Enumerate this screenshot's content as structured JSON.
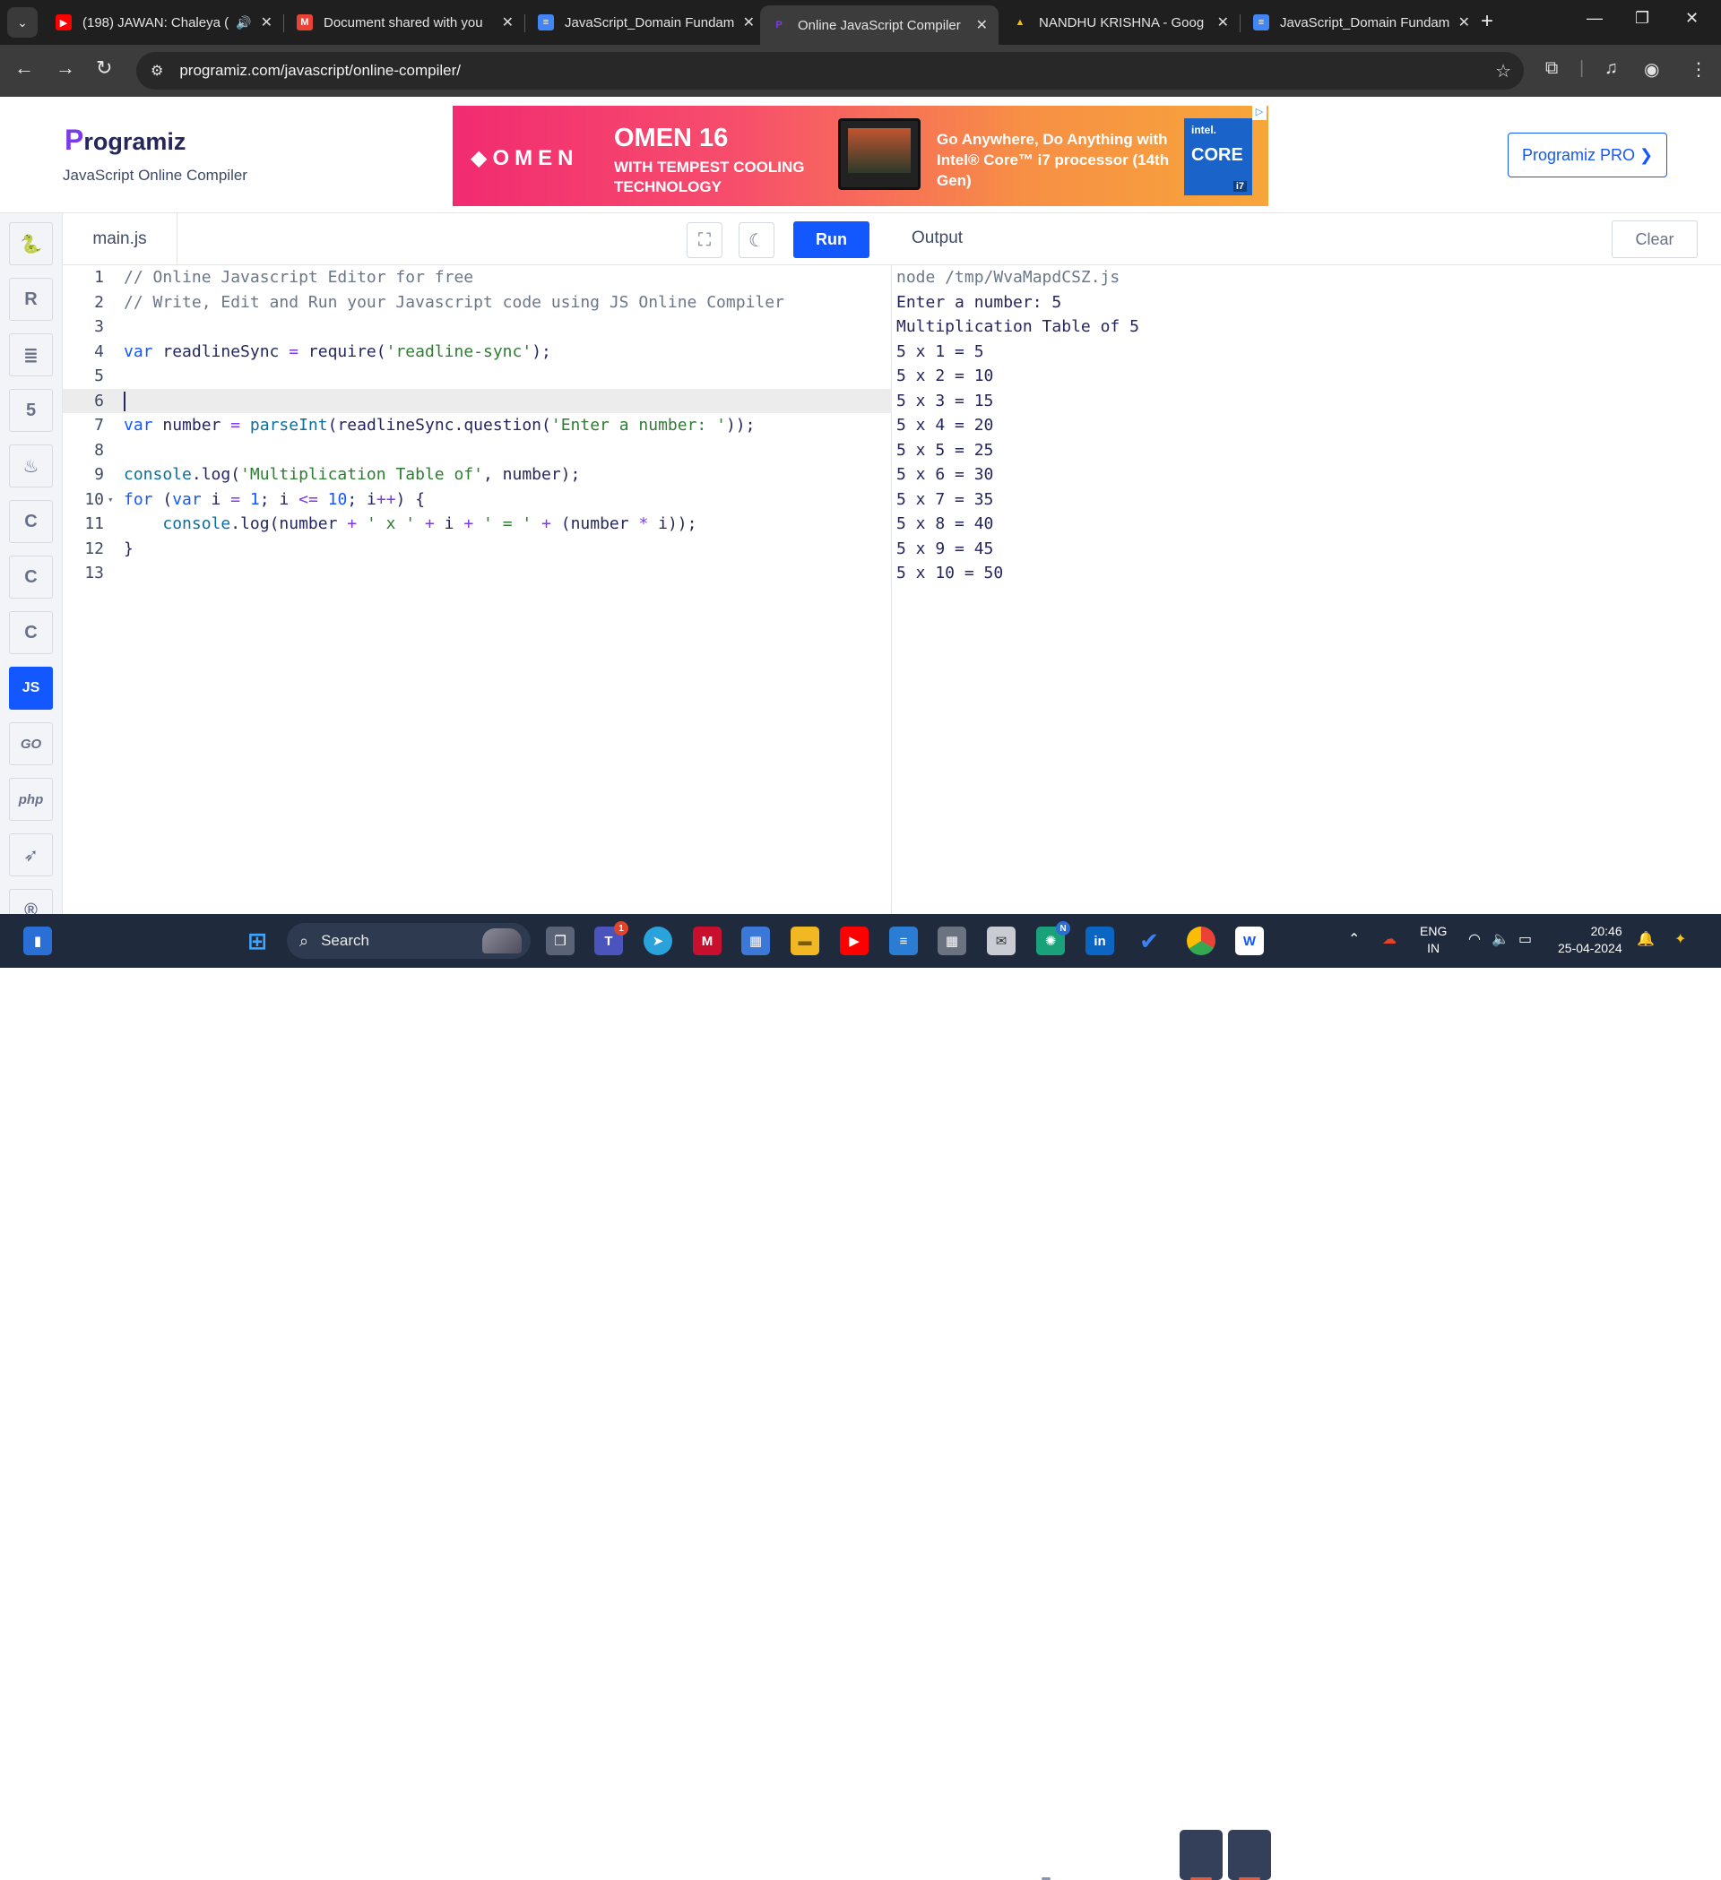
{
  "browser": {
    "tabs": [
      {
        "title": "(198) JAWAN: Chaleya (",
        "icon": "youtube-icon",
        "icon_color": "#ff0000",
        "extra": "speaker-icon"
      },
      {
        "title": "Document shared with you",
        "icon": "gmail-icon",
        "icon_color": "#ea4335"
      },
      {
        "title": "JavaScript_Domain Fundam",
        "icon": "google-docs-icon",
        "icon_color": "#4285f4"
      },
      {
        "title": "Online JavaScript Compiler",
        "icon": "programiz-icon",
        "icon_color": "#7c3aed",
        "active": true
      },
      {
        "title": "NANDHU KRISHNA - Goog",
        "icon": "google-drive-icon",
        "icon_color": "#fbbc04"
      },
      {
        "title": "JavaScript_Domain Fundam",
        "icon": "google-docs-icon",
        "icon_color": "#4285f4"
      }
    ],
    "url": "programiz.com/javascript/online-compiler/"
  },
  "header": {
    "logo_initial": "P",
    "logo_text": "rogramiz",
    "subtitle": "JavaScript Online Compiler",
    "pro_button": "Programiz PRO ❯"
  },
  "ad": {
    "brand": "◆OMEN",
    "headline": "OMEN 16",
    "subline": "WITH TEMPEST COOLING TECHNOLOGY",
    "tagline": "Go Anywhere, Do Anything with Intel® Core™ i7 processor (14th Gen)",
    "intel_brand": "intel.",
    "intel_core": "CORE",
    "intel_tier": "i7"
  },
  "sidebar": {
    "languages": [
      {
        "name": "python-icon",
        "glyph": "🐍"
      },
      {
        "name": "r-icon",
        "glyph": "R"
      },
      {
        "name": "sql-icon",
        "glyph": "≣"
      },
      {
        "name": "html-icon",
        "glyph": "5"
      },
      {
        "name": "java-icon",
        "glyph": "♨"
      },
      {
        "name": "c-icon",
        "glyph": "C"
      },
      {
        "name": "cpp-icon",
        "glyph": "C"
      },
      {
        "name": "csharp-icon",
        "glyph": "C"
      },
      {
        "name": "javascript-icon",
        "glyph": "JS",
        "active": true
      },
      {
        "name": "go-icon",
        "glyph": "GO"
      },
      {
        "name": "php-icon",
        "glyph": "php"
      },
      {
        "name": "swift-icon",
        "glyph": "➶"
      },
      {
        "name": "rust-icon",
        "glyph": "®"
      }
    ]
  },
  "editor": {
    "file_name": "main.js",
    "run_label": "Run",
    "current_line": 6,
    "lines": [
      "<span class=\"cm\">// Online Javascript Editor for free</span>",
      "<span class=\"cm\">// Write, Edit and Run your Javascript code using JS Online Compiler</span>",
      "",
      "<span class=\"kw\">var</span> readlineSync <span class=\"op\">=</span> require(<span class=\"str\">'readline-sync'</span>);",
      "",
      "<span class=\"caret\"></span>",
      "<span class=\"kw\">var</span> number <span class=\"op\">=</span> <span class=\"fn\">parseInt</span>(readlineSync.question(<span class=\"str\">'Enter a number: '</span>));",
      "",
      "<span class=\"fn\">console</span>.log(<span class=\"str\">'Multiplication Table of'</span>, number);",
      "<span class=\"kw\">for</span> (<span class=\"kw\">var</span> i <span class=\"op\">=</span> <span class=\"num\">1</span>; i <span class=\"op\">&lt;=</span> <span class=\"num\">10</span>; i<span class=\"op\">++</span>) {",
      "    <span class=\"fn\">console</span>.log(number <span class=\"op\">+</span> <span class=\"str\">' x '</span> <span class=\"op\">+</span> i <span class=\"op\">+</span> <span class=\"str\">' = '</span> <span class=\"op\">+</span> (number <span class=\"op\">*</span> i));",
      "}",
      ""
    ]
  },
  "output": {
    "title": "Output",
    "clear_label": "Clear",
    "command": "node /tmp/WvaMapdCSZ.js",
    "lines": [
      "Enter a number: 5",
      "Multiplication Table of 5",
      "5 x 1 = 5",
      "5 x 2 = 10",
      "5 x 3 = 15",
      "5 x 4 = 20",
      "5 x 5 = 25",
      "5 x 6 = 30",
      "5 x 7 = 35",
      "5 x 8 = 40",
      "5 x 9 = 45",
      "5 x 10 = 50"
    ]
  },
  "taskbar": {
    "search_placeholder": "Search",
    "teams_badge": "1",
    "chatgpt_badge": "N",
    "lang_line1": "ENG",
    "lang_line2": "IN",
    "time": "20:46",
    "date": "25-04-2024"
  }
}
